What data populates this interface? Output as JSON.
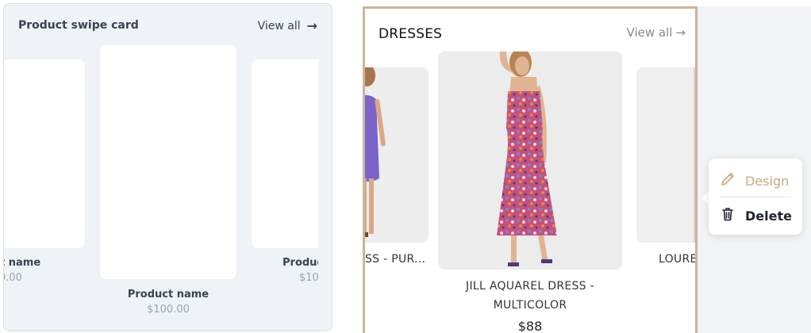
{
  "left_panel": {
    "title": "Product swipe card",
    "view_all": "View all",
    "cards": [
      {
        "name": "t name",
        "price": "0.00"
      },
      {
        "name": "Product name",
        "price": "$100.00"
      },
      {
        "name": "Produc",
        "price": "$10"
      }
    ]
  },
  "right_panel": {
    "title": "DRESSES",
    "view_all": "View all",
    "products": [
      {
        "name": "SS - PUR...",
        "price": ""
      },
      {
        "name_line1": "JILL AQUAREL DRESS -",
        "name_line2": "MULTICOLOR",
        "price": "$88"
      },
      {
        "name": "LOURE",
        "price": ""
      }
    ]
  },
  "context_menu": {
    "design_label": "Design",
    "delete_label": "Delete"
  },
  "colors": {
    "accent_border": "#c9b49b",
    "design_text": "#c9a77e",
    "dress_pattern_main": "#c7507a",
    "purple_dress": "#7b63c9"
  }
}
